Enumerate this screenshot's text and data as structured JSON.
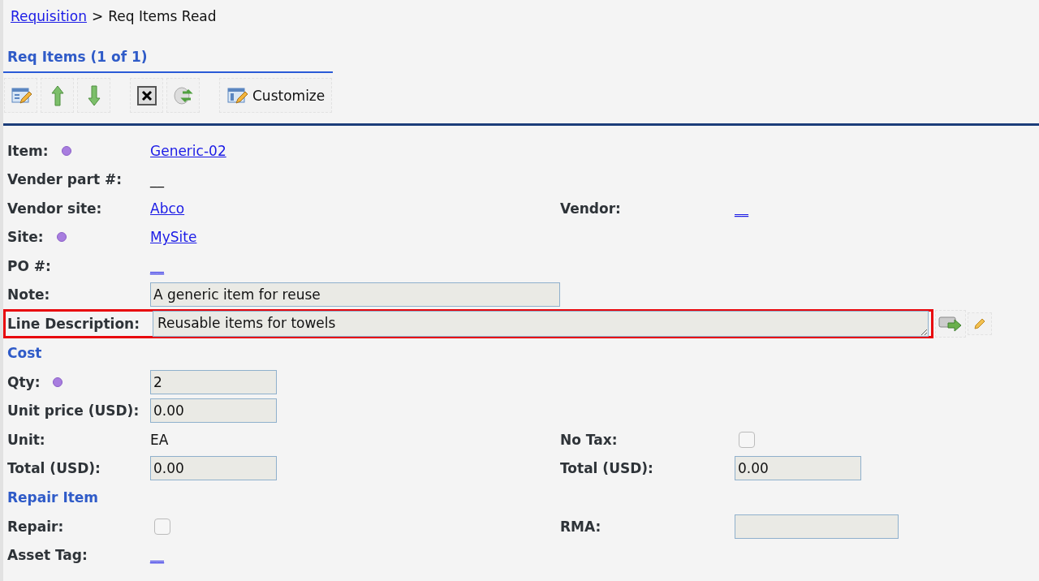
{
  "breadcrumb": {
    "link": "Requisition",
    "separator": ">",
    "current": "Req Items Read"
  },
  "section_title": "Req Items (1 of 1)",
  "toolbar": {
    "customize_label": "Customize"
  },
  "rows": [
    {
      "kind": "field",
      "left": {
        "label": "Item:",
        "required": true,
        "field": {
          "kind": "link",
          "value": "Generic-02"
        }
      }
    },
    {
      "kind": "field",
      "left": {
        "label": "Vender part #:",
        "required": false,
        "field": {
          "kind": "text",
          "value": "__"
        }
      }
    },
    {
      "kind": "field",
      "left": {
        "label": "Vendor site:",
        "required": false,
        "field": {
          "kind": "link",
          "value": "Abco"
        }
      },
      "right": {
        "label": "Vendor:",
        "required": false,
        "field": {
          "kind": "link",
          "value": "__"
        }
      }
    },
    {
      "kind": "field",
      "left": {
        "label": "Site:",
        "required": true,
        "field": {
          "kind": "link",
          "value": "MySite"
        }
      }
    },
    {
      "kind": "field",
      "left": {
        "label": "PO #:",
        "required": false,
        "field": {
          "kind": "link",
          "value": "__"
        }
      }
    },
    {
      "kind": "field",
      "left": {
        "label": "Note:",
        "required": false,
        "field": {
          "kind": "wide-input",
          "value": "A generic item for reuse"
        }
      }
    },
    {
      "kind": "textarea",
      "highlighted": true,
      "left": {
        "label": "Line Description:",
        "required": false,
        "field": {
          "kind": "textarea",
          "value": "Reusable items for towels"
        }
      }
    },
    {
      "kind": "heading",
      "text": "Cost"
    },
    {
      "kind": "field",
      "left": {
        "label": "Qty:",
        "required": true,
        "field": {
          "kind": "input",
          "value": "2"
        }
      }
    },
    {
      "kind": "field",
      "left": {
        "label": "Unit price (USD):",
        "required": false,
        "field": {
          "kind": "input",
          "value": "0.00"
        }
      }
    },
    {
      "kind": "field",
      "left": {
        "label": "Unit:",
        "required": false,
        "field": {
          "kind": "text",
          "value": "EA"
        }
      },
      "right": {
        "label": "No Tax:",
        "required": false,
        "field": {
          "kind": "checkbox",
          "checked": false
        }
      }
    },
    {
      "kind": "field",
      "left": {
        "label": "Total (USD):",
        "required": false,
        "field": {
          "kind": "input",
          "value": "0.00"
        }
      },
      "right": {
        "label": "Total (USD):",
        "required": false,
        "field": {
          "kind": "input",
          "value": "0.00"
        }
      }
    },
    {
      "kind": "heading",
      "text": "Repair Item"
    },
    {
      "kind": "field",
      "left": {
        "label": "Repair:",
        "required": false,
        "field": {
          "kind": "checkbox",
          "checked": false
        }
      },
      "right": {
        "label": "RMA:",
        "required": false,
        "field": {
          "kind": "input-long"
        }
      }
    },
    {
      "kind": "field",
      "left": {
        "label": "Asset Tag:",
        "required": false,
        "field": {
          "kind": "link",
          "value": "__"
        }
      }
    }
  ]
}
